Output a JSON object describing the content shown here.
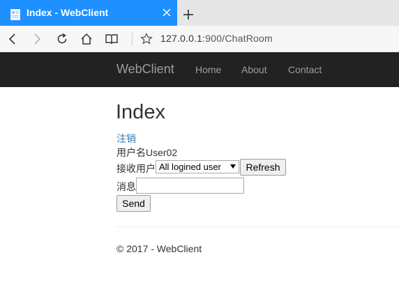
{
  "browser": {
    "tab_title": "Index - WebClient",
    "address_host": "127.0.0.1",
    "address_rest": ":900/ChatRoom",
    "tab_color": "#1e90ff"
  },
  "site": {
    "brand": "WebClient",
    "nav": [
      "Home",
      "About",
      "Contact"
    ],
    "header_bg": "#222222"
  },
  "main": {
    "title": "Index",
    "logout_link": "注销",
    "username_label": "用户名",
    "username_value": "User02",
    "receiver_label": "接收用户",
    "receiver_selected": "All logined user",
    "refresh_button": "Refresh",
    "message_label": "消息",
    "message_value": "",
    "send_button": "Send"
  },
  "footer": {
    "text": "© 2017 - WebClient"
  }
}
